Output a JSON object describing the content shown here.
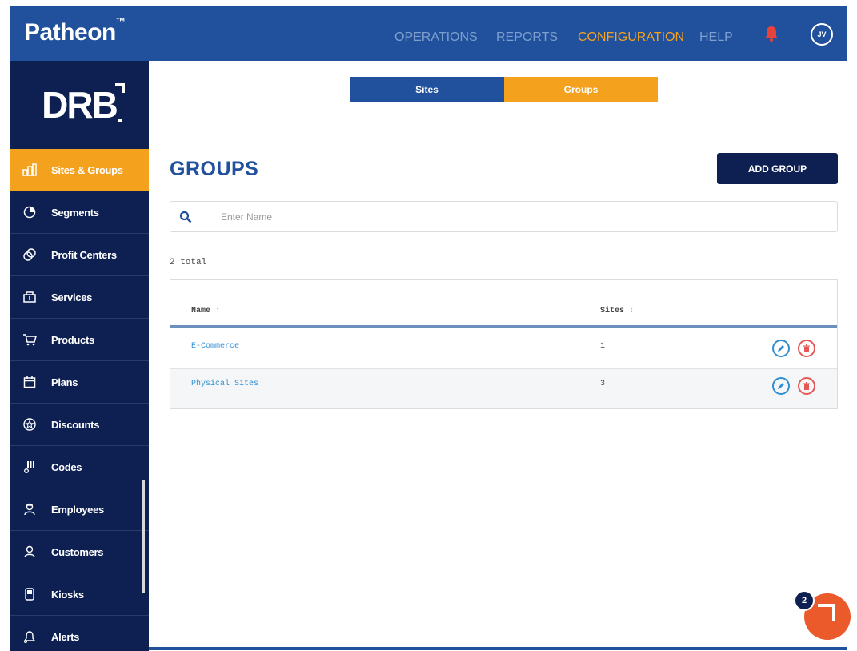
{
  "topbar": {
    "logo": "Patheon",
    "logo_mark": "™",
    "nav": [
      "OPERATIONS",
      "REPORTS",
      "CONFIGURATION",
      "HELP"
    ],
    "active_nav": "CONFIGURATION",
    "avatar_initials": "JV",
    "accent_color": "#f4a21e",
    "bar_color": "#21509c"
  },
  "sidebar": {
    "brand": "DRB",
    "items": [
      {
        "label": "Sites & Groups",
        "icon": "sites-groups-icon",
        "active": true
      },
      {
        "label": "Segments",
        "icon": "pie-chart-icon"
      },
      {
        "label": "Profit Centers",
        "icon": "profit-centers-icon"
      },
      {
        "label": "Services",
        "icon": "services-icon"
      },
      {
        "label": "Products",
        "icon": "cart-icon"
      },
      {
        "label": "Plans",
        "icon": "calendar-icon"
      },
      {
        "label": "Discounts",
        "icon": "star-badge-icon"
      },
      {
        "label": "Codes",
        "icon": "codes-icon"
      },
      {
        "label": "Employees",
        "icon": "employee-icon"
      },
      {
        "label": "Customers",
        "icon": "customer-icon"
      },
      {
        "label": "Kiosks",
        "icon": "kiosk-icon"
      },
      {
        "label": "Alerts",
        "icon": "alert-icon"
      }
    ]
  },
  "tabs": {
    "sites": "Sites",
    "groups": "Groups",
    "active": "Groups"
  },
  "main": {
    "title": "GROUPS",
    "add_button": "ADD GROUP",
    "search_placeholder": "Enter Name",
    "total": "2 total"
  },
  "table": {
    "columns": [
      {
        "label": "Name",
        "sort": "↑"
      },
      {
        "label": "Sites",
        "sort": "↕"
      }
    ],
    "rows": [
      {
        "name": "E-Commerce",
        "sites": "1"
      },
      {
        "name": "Physical Sites",
        "sites": "3"
      }
    ]
  },
  "chat": {
    "badge": "2"
  }
}
